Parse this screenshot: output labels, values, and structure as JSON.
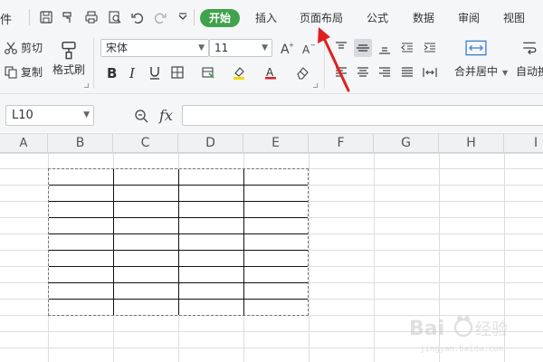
{
  "menubar": {
    "edge_text": "件",
    "tabs": [
      "开始",
      "插入",
      "页面布局",
      "公式",
      "数据",
      "审阅",
      "视图"
    ],
    "active_tab": "开始"
  },
  "ribbon": {
    "cut_label": "剪切",
    "copy_label": "复制",
    "format_painter_label": "格式刷",
    "font_name": "宋体",
    "font_size": "11",
    "merge_center_label": "合并居中",
    "auto_wrap_label": "自动换"
  },
  "formula_bar": {
    "name_box": "L10",
    "fx_label": "fx",
    "formula_value": ""
  },
  "columns": [
    "A",
    "B",
    "C",
    "D",
    "E",
    "F",
    "G",
    "H",
    "I"
  ],
  "selection_table": {
    "rows": 9,
    "cols": 4
  },
  "watermark": "Bai 经验",
  "colors": {
    "active_tab": "#3fa34d",
    "annotation_arrow": "#e02020",
    "font_color_underline": "#e02020",
    "fill_color_underline": "#f5d90a"
  }
}
